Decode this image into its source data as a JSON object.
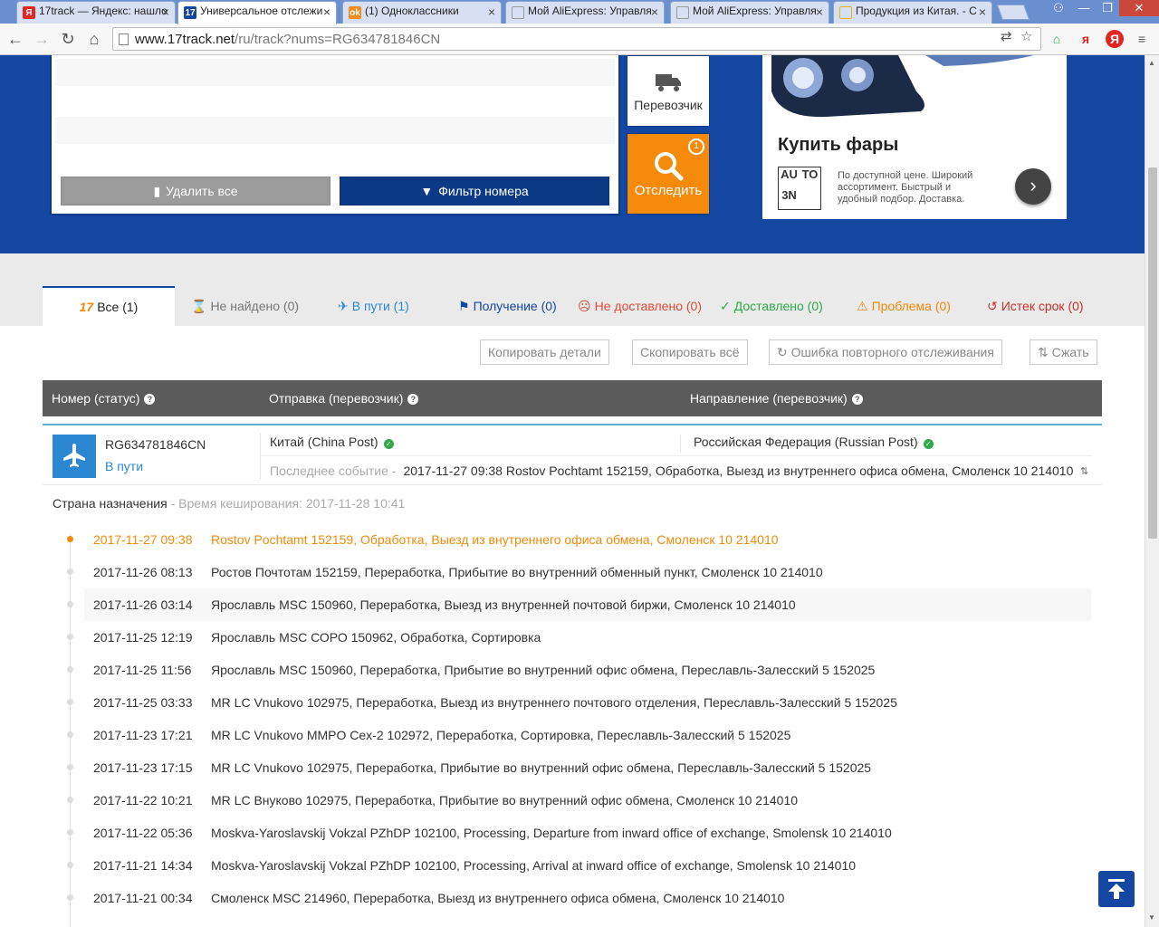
{
  "browser": {
    "tabs": [
      {
        "label": "17track — Яндекс: нашло",
        "fav": "Я",
        "fav_color": "#e52620"
      },
      {
        "label": "Универсальное отслежи",
        "fav": "17",
        "fav_color": "#1447a1"
      },
      {
        "label": "(1) Одноклассники",
        "fav": "ok",
        "fav_color": "#f38a1d"
      },
      {
        "label": "Мой AliExpress: Управля",
        "fav": "",
        "fav_color": "#999999"
      },
      {
        "label": "Мой AliExpress: Управля",
        "fav": "",
        "fav_color": "#999999"
      },
      {
        "label": "Продукция из Китая. - С",
        "fav": "",
        "fav_color": "#e6b31c"
      }
    ],
    "url_host": "www.17track.net",
    "url_path": "/ru/track?nums=RG634781846CN"
  },
  "input_panel": {
    "delete_all": "Удалить все",
    "filter_numbers": "Фильтр номера",
    "carrier": "Перевозчик",
    "track": "Отследить",
    "track_badge": "1"
  },
  "ad": {
    "title": "Купить фары",
    "logo": [
      "AU",
      "TO",
      "3N",
      ""
    ],
    "description": "По доступной цене. Широкий ассортимент. Быстрый и удобный подбор. Доставка."
  },
  "filters": [
    {
      "key": "all",
      "label": "Все (1)",
      "color": "#222222",
      "icon": "17"
    },
    {
      "key": "not-found",
      "label": "Не найдено (0)",
      "color": "#777777",
      "icon": "⌛"
    },
    {
      "key": "in-transit",
      "label": "В пути (1)",
      "color": "#2b87d1",
      "icon": "✈"
    },
    {
      "key": "pickup",
      "label": "Получение (0)",
      "color": "#1447a1",
      "icon": "⚑"
    },
    {
      "key": "undelivered",
      "label": "Не доставлено (0)",
      "color": "#e04a3a",
      "icon": "☹"
    },
    {
      "key": "delivered",
      "label": "Доставлено (0)",
      "color": "#2fa94a",
      "icon": "✓"
    },
    {
      "key": "problem",
      "label": "Проблема (0)",
      "color": "#ef8a0c",
      "icon": "⚠"
    },
    {
      "key": "expired",
      "label": "Истек срок (0)",
      "color": "#c9302c",
      "icon": "↺"
    }
  ],
  "actions": {
    "copy_details": "Копировать детали",
    "copy_all": "Скопировать всё",
    "retrack_error": "Ошибка повторного отслеживания",
    "collapse": "Сжать"
  },
  "table": {
    "col_number": "Номер (статус)",
    "col_origin": "Отправка (перевозчик)",
    "col_dest": "Направление (перевозчик)"
  },
  "parcel": {
    "number": "RG634781846CN",
    "status": "В пути",
    "origin": "Китай (China Post)",
    "destination": "Российская Федерация (Russian Post)",
    "last_event_label": "Последнее событие -",
    "last_event": "2017-11-27 09:38 Rostov Pochtamt 152159, Обработка, Выезд из внутреннего офиса обмена, Смоленск 10 214010",
    "dest_country_label": "Страна назначения",
    "cache_time": " - Время кеширования: 2017-11-28 10:41"
  },
  "events": [
    {
      "time": "2017-11-27 09:38",
      "desc": "Rostov Pochtamt 152159, Обработка, Выезд из внутреннего офиса обмена, Смоленск 10 214010"
    },
    {
      "time": "2017-11-26 08:13",
      "desc": "Ростов Почтотам 152159, Переработка, Прибытие во внутренний обменный пункт, Смоленск 10 214010"
    },
    {
      "time": "2017-11-26 03:14",
      "desc": "Ярославль MSC 150960, Переработка, Выезд из внутренней почтовой биржи, Смоленск 10 214010"
    },
    {
      "time": "2017-11-25 12:19",
      "desc": "Ярославль MSC СОРО 150962, Обработка, Сортировка"
    },
    {
      "time": "2017-11-25 11:56",
      "desc": "Ярославль MSC 150960, Переработка, Прибытие во внутренний офис обмена, Переславль-Залесский 5 152025"
    },
    {
      "time": "2017-11-25 03:33",
      "desc": "MR LC Vnukovo 102975, Переработка, Выезд из внутреннего почтового отделения, Переславль-Залесский 5 152025"
    },
    {
      "time": "2017-11-23 17:21",
      "desc": "MR LC Vnukovo MMPO Cex-2 102972, Переработка, Сортировка, Переславль-Залесский 5 152025"
    },
    {
      "time": "2017-11-23 17:15",
      "desc": "MR LC Vnukovo 102975, Переработка, Прибытие во внутренний офис обмена, Переславль-Залесский 5 152025"
    },
    {
      "time": "2017-11-22 10:21",
      "desc": "MR LC Внуково 102975, Переработка, Прибытие во внутренний офис обмена, Смоленск 10 214010"
    },
    {
      "time": "2017-11-22 05:36",
      "desc": "Moskva-Yaroslavskij Vokzal PZhDP 102100, Processing, Departure from inward office of exchange, Smolensk 10 214010"
    },
    {
      "time": "2017-11-21 14:34",
      "desc": "Moskva-Yaroslavskij Vokzal PZhDP 102100, Processing, Arrival at inward office of exchange, Smolensk 10 214010"
    },
    {
      "time": "2017-11-21 00:34",
      "desc": "Смоленск MSC 214960, Переработка, Выезд из внутреннего офиса обмена, Смоленск 10 214010"
    }
  ]
}
